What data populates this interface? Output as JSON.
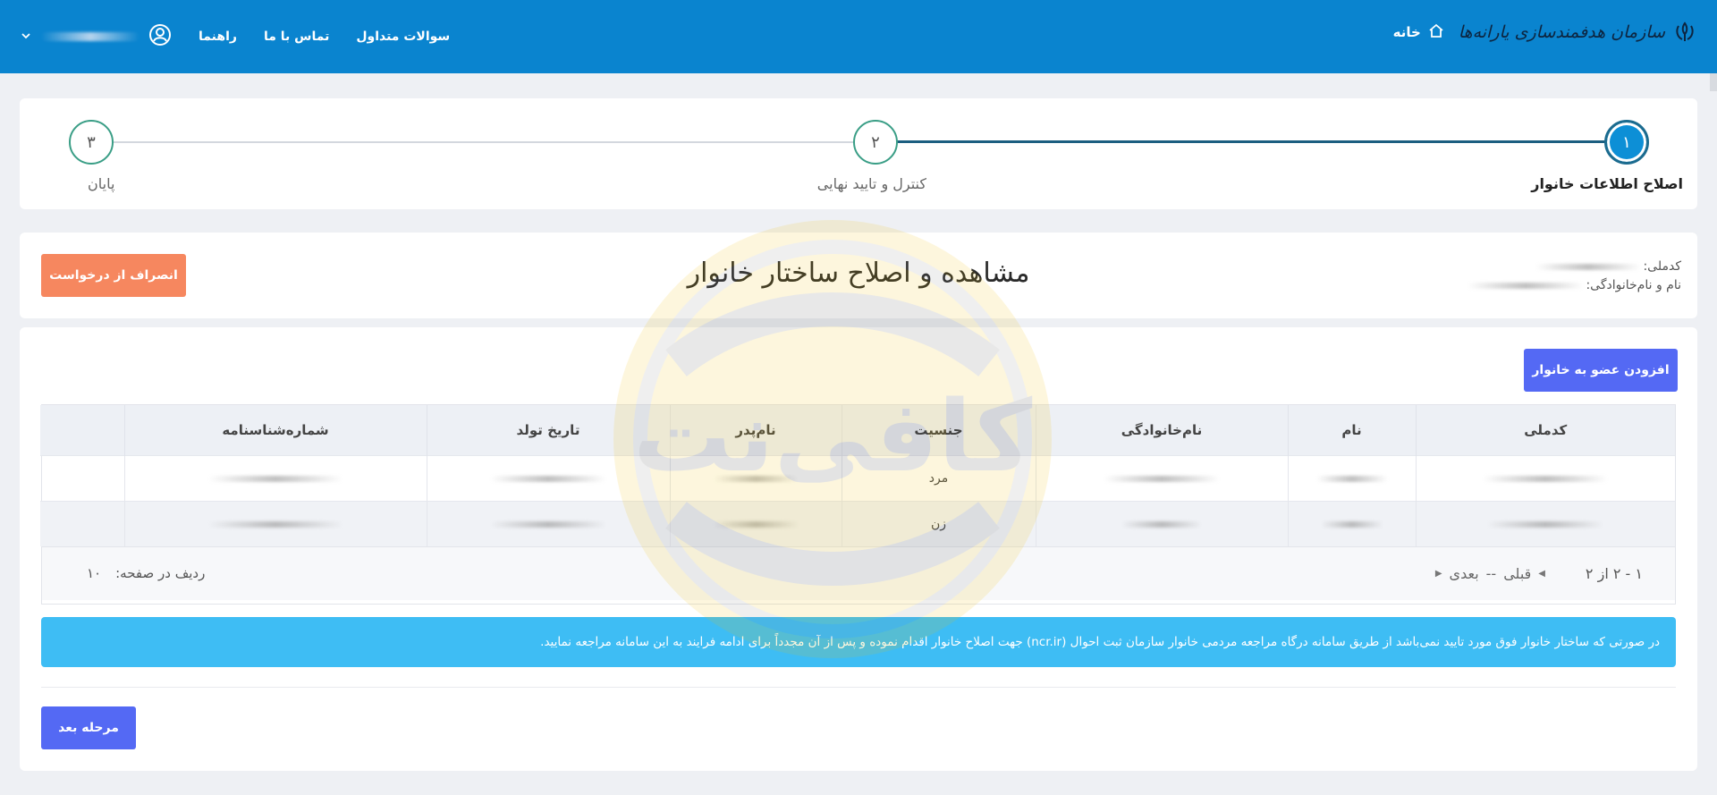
{
  "header": {
    "logo_text": "سازمان هدفمندسازی یارانه‌ها",
    "home_label": "خانه",
    "nav": [
      "راهنما",
      "تماس با ما",
      "سوالات متداول"
    ]
  },
  "stepper": {
    "steps": [
      {
        "number": "۱",
        "label": "اصلاح اطلاعات خانوار"
      },
      {
        "number": "۲",
        "label": "کنترل و تایید نهایی"
      },
      {
        "number": "۳",
        "label": "پایان"
      }
    ],
    "active": 1
  },
  "page": {
    "title": "مشاهده و اصلاح ساختار خانوار",
    "national_code_label": "کدملی:",
    "full_name_label": "نام و نام‌خانوادگی:",
    "cancel_button": "انصراف از درخواست",
    "add_member_button": "افزودن عضو به خانوار",
    "next_button": "مرحله بعد"
  },
  "table": {
    "columns": [
      "کدملی",
      "نام",
      "نام‌خانوادگی",
      "جنسیت",
      "نام‌پدر",
      "تاریخ تولد",
      "شماره‌شناسنامه",
      ""
    ],
    "rows": [
      {
        "gender": "مرد"
      },
      {
        "gender": "زن"
      }
    ]
  },
  "pager": {
    "range": "۱ - ۲ از ۲",
    "prev": "قبلی",
    "separator": "--",
    "next": "بعدی",
    "rows_label": "ردیف در صفحه:",
    "rows_value": "۱۰"
  },
  "alert": {
    "text": "در صورتی که ساختار خانوار فوق مورد تایید نمی‌باشد از طریق سامانه درگاه مراجعه مردمی خانوار سازمان ثبت احوال (ncr.ir) جهت اصلاح خانوار اقدام نموده و پس از آن مجدداً برای ادامه فرایند به این سامانه مراجعه نمایید."
  },
  "watermark": {
    "text": "کافی‌نت"
  },
  "colors": {
    "topbar": "#0a84cf",
    "primary_button": "#5469f4",
    "cancel_button": "#f6875f",
    "alert": "#3ebdf4",
    "step_active": "#0d8fd6"
  }
}
